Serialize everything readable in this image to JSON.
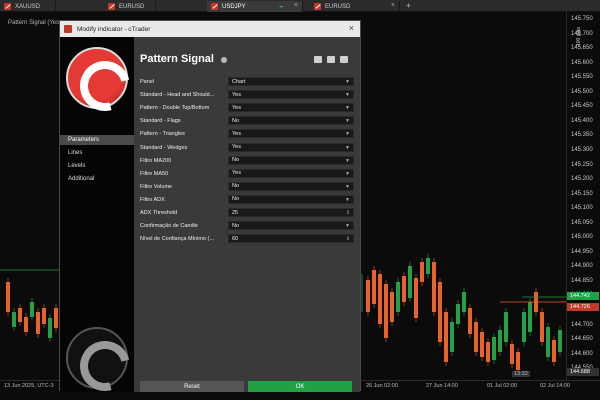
{
  "tabs": [
    {
      "label": "XAUUSD"
    },
    {
      "label": "EURUSD"
    },
    {
      "label": "USDJPY"
    },
    {
      "label": "EURUSD"
    }
  ],
  "chart": {
    "title": "Pattern Signal (Yes...",
    "pips_label": "100 pips",
    "price_ticks": [
      "145.750",
      "145.700",
      "145.650",
      "145.600",
      "145.550",
      "145.500",
      "145.450",
      "145.400",
      "145.350",
      "145.300",
      "145.250",
      "145.200",
      "145.150",
      "145.100",
      "145.050",
      "145.000",
      "144.950",
      "144.900",
      "144.850",
      "144.800",
      "144.750",
      "144.700",
      "144.650",
      "144.600",
      "144.550"
    ],
    "price_tag_red": "144.726",
    "price_tag_green": "144.742",
    "price_tag_dark": "144.688",
    "time_labels": [
      "13 Jun 2025, UTC-3",
      "26 Jun 02:00",
      "27 Jun 14:00",
      "01 Jul 02:00",
      "02 Jul 14:00"
    ],
    "bottom_readout": "13:32"
  },
  "dialog": {
    "title": "Modify indicator - cTrader",
    "panel_title": "Pattern Signal",
    "nav": [
      "Parameters",
      "Lines",
      "Levels",
      "Additional"
    ],
    "params": [
      {
        "label": "Panel",
        "value": "Chart"
      },
      {
        "label": "Standard - Head and Should...",
        "value": "Yes"
      },
      {
        "label": "Pattern - Double Top/Bottom",
        "value": "Yes"
      },
      {
        "label": "Standard - Flags",
        "value": "No"
      },
      {
        "label": "Pattern - Triangles",
        "value": "Yes"
      },
      {
        "label": "Standard - Wedges",
        "value": "Yes"
      },
      {
        "label": "Filtro MA200",
        "value": "No"
      },
      {
        "label": "Filtro MA50",
        "value": "Yes"
      },
      {
        "label": "Filtro Volume",
        "value": "No"
      },
      {
        "label": "Filtro ADX",
        "value": "No"
      },
      {
        "label": "ADX Threshold",
        "value": "25"
      },
      {
        "label": "Confirmação de Candle",
        "value": "No"
      },
      {
        "label": "Nível de Confiança Mínimo (...",
        "value": "60"
      }
    ],
    "reset_label": "Reset",
    "ok_label": "OK"
  },
  "colors": {
    "bull": "#26a047",
    "bear": "#e8622c",
    "accent": "#c0392b",
    "ok": "#22a045"
  }
}
